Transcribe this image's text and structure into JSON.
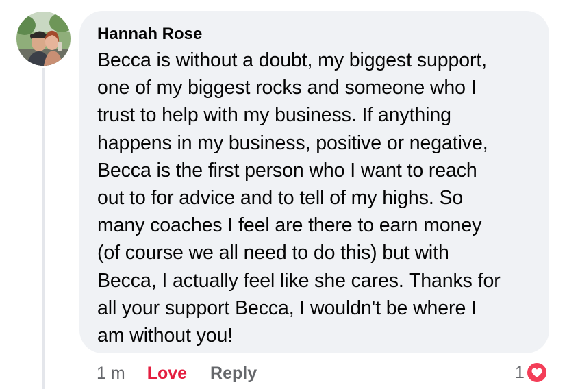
{
  "comment": {
    "author": "Hannah Rose",
    "lines": [
      "Becca is without a doubt, my biggest support,",
      "one of my biggest rocks and someone who I",
      "trust to help with my business. If anything",
      "happens in my business, positive or negative,",
      "Becca is the first person who I want to reach",
      "out to for advice and to tell of my highs. So",
      "many coaches I feel are there to earn money",
      "(of course we all need to do this) but with",
      "Becca, I actually feel like she cares. Thanks for",
      "all your support Becca, I wouldn't be where I",
      "am without you!"
    ]
  },
  "meta": {
    "timestamp": "1 m",
    "love_label": "Love",
    "reply_label": "Reply"
  },
  "reactions": {
    "count": "1",
    "icon": "heart-icon",
    "badge_color": "#f33e58"
  },
  "colors": {
    "bubble": "#f0f2f5",
    "love_active": "#e41e3f",
    "secondary_text": "#65676b"
  }
}
